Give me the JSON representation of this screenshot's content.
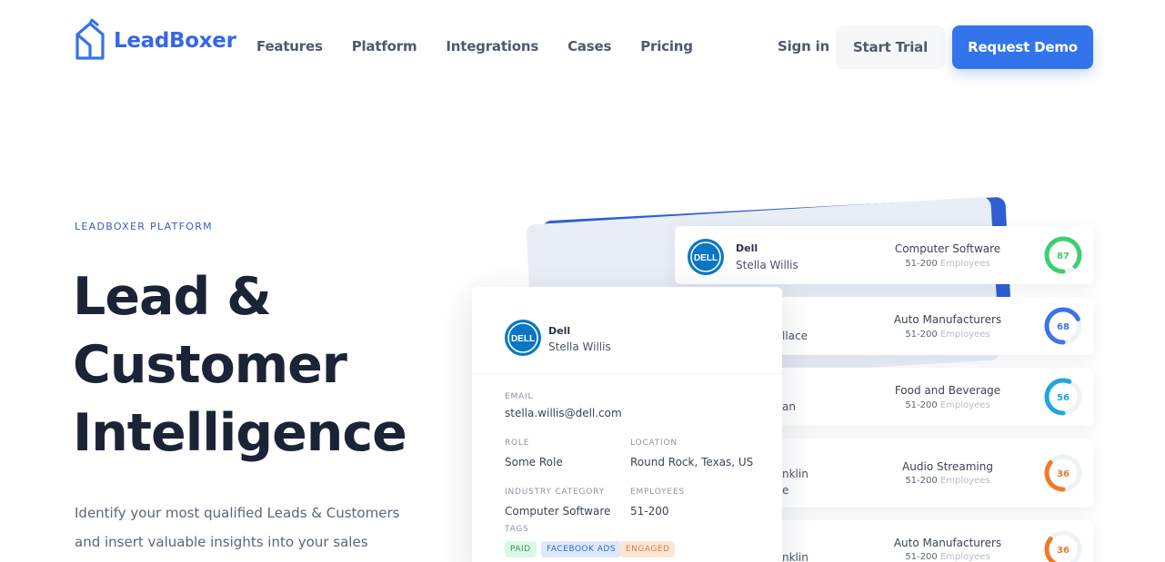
{
  "brand": {
    "name": "LeadBoxer",
    "accent": "#3374ec"
  },
  "nav": {
    "links": [
      "Features",
      "Platform",
      "Integrations",
      "Cases",
      "Pricing"
    ],
    "signin": "Sign in",
    "trial": "Start Trial",
    "demo": "Request Demo"
  },
  "hero": {
    "eyebrow": "LEADBOXER PLATFORM",
    "headline": [
      "Lead &",
      "Customer",
      "Intelligence"
    ],
    "sub": [
      "Identify your most qualified Leads & Customers",
      "and insert valuable insights into your sales"
    ]
  },
  "leads": [
    {
      "company": "Dell",
      "name": "Stella Willis",
      "industry": "Computer Software",
      "employees": "51-200",
      "employees_label": "Employees",
      "score": 87,
      "score_color": "#3ecf6e"
    },
    {
      "name_fragment": "llace",
      "industry": "Auto Manufacturers",
      "employees": "51-200",
      "employees_label": "Employees",
      "score": 68,
      "score_color": "#3b74e6"
    },
    {
      "name_fragment": "an",
      "industry": "Food and Beverage",
      "employees": "51-200",
      "employees_label": "Employees",
      "score": 56,
      "score_color": "#1fa5e0"
    },
    {
      "name_fragment": [
        "nklin",
        "e"
      ],
      "industry": "Audio Streaming",
      "employees": "51-200",
      "employees_label": "Employees",
      "score": 36,
      "score_color": "#f07a28"
    },
    {
      "name_fragment": "nklin",
      "industry": "Auto Manufacturers",
      "employees": "51-200",
      "employees_label": "Employees",
      "score": 36,
      "score_color": "#f07a28"
    }
  ],
  "detail": {
    "company": "Dell",
    "name": "Stella Willis",
    "email_label": "EMAIL",
    "email": "stella.willis@dell.com",
    "role_label": "ROLE",
    "role": "Some Role",
    "location_label": "LOCATION",
    "location": "Round Rock, Texas, US",
    "industry_label": "INDUSTRY CATEGORY",
    "industry": "Computer Software",
    "employees_label": "EMPLOYEES",
    "employees": "51-200",
    "tags_label": "TAGS",
    "tags": [
      {
        "label": "PAID",
        "bg": "#dcf7e5",
        "fg": "#2f9d58"
      },
      {
        "label": "FACEBOOK ADS",
        "bg": "#dde8fb",
        "fg": "#3466c9"
      },
      {
        "label": "ENGAGED",
        "bg": "#fde6d4",
        "fg": "#dc7a3a"
      }
    ]
  },
  "icons": [
    "leadboxer-logo-icon",
    "dell-logo-icon",
    "score-gauge-icon"
  ]
}
